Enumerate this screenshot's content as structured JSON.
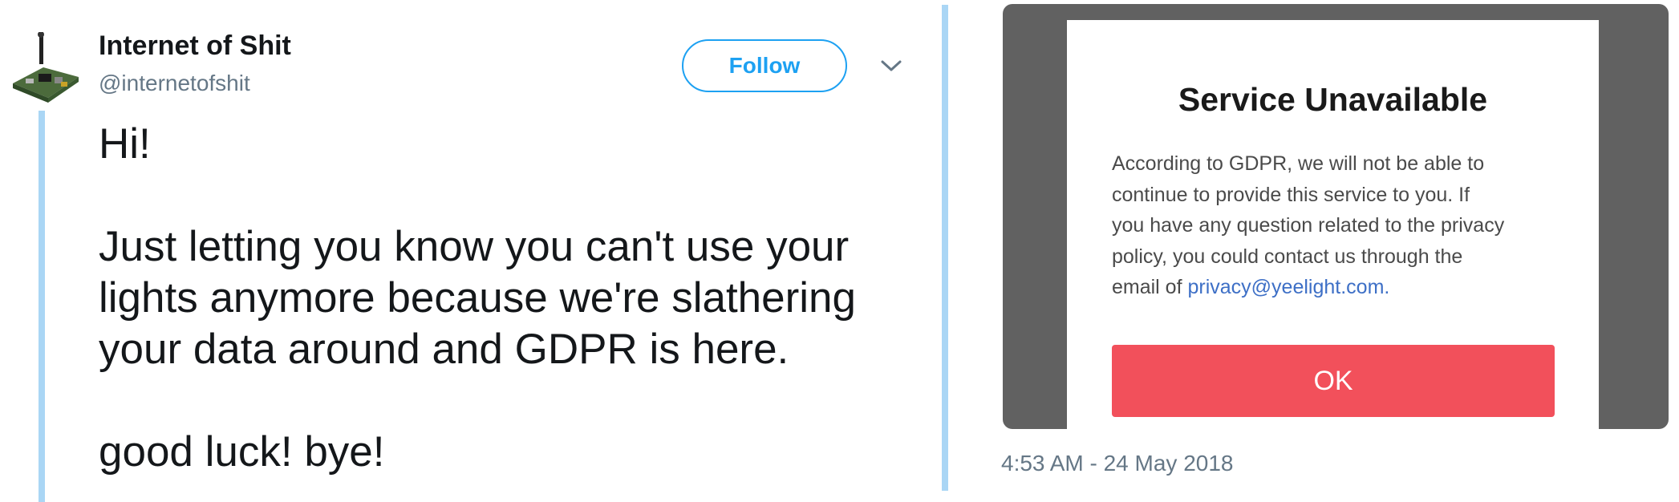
{
  "author": {
    "name": "Internet of Shit",
    "handle": "@internetofshit",
    "avatar_icon": "circuit-board-icon"
  },
  "follow_button": {
    "label": "Follow"
  },
  "menu_icon": "chevron-down-icon",
  "tweet": {
    "lines": [
      "Hi!",
      "Just letting you know you can't use your",
      "lights anymore because we're slathering",
      "your data around and GDPR is here.",
      "good luck! bye!"
    ]
  },
  "media": {
    "dialog": {
      "title": "Service Unavailable",
      "body_lines": [
        "According to GDPR, we will not be able to",
        "continue to provide this service to you. If",
        "you have any question related to the privacy",
        "policy, you could contact us through the"
      ],
      "email_prefix": "email of ",
      "email": "privacy@yeelight.com",
      "email_suffix": ".",
      "ok_label": "OK"
    }
  },
  "timestamp": "4:53 AM - 24 May 2018",
  "colors": {
    "accent": "#1da1f2",
    "thread_line": "#aad6f5",
    "ok_button": "#f2505b",
    "media_bg": "#616161",
    "link": "#3d6fc6"
  }
}
